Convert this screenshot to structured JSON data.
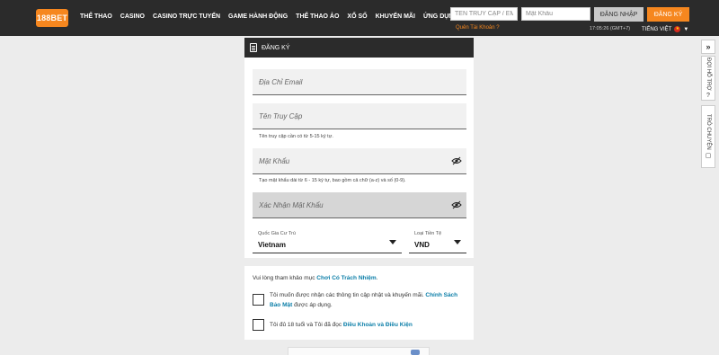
{
  "brand": {
    "logo_text": "188BET",
    "accent": "#f6871f",
    "dark": "#2b2b2b"
  },
  "nav": {
    "items": [
      "THỂ THAO",
      "CASINO",
      "CASINO TRỰC TUYẾN",
      "GAME HÀNH ĐỘNG",
      "THỂ THAO ẢO",
      "XỔ SỐ",
      "KHUYẾN MÃI",
      "ỨNG DỤNG"
    ]
  },
  "login": {
    "username_placeholder": "TÊN TRUY CẬP / EMAIL",
    "password_placeholder": "Mật Khẩu",
    "login_label": "ĐĂNG NHẬP",
    "register_label": "ĐĂNG KÝ",
    "forgot_label": "Quên Tài Khoản ?",
    "clock": "17:05:26 (GMT+7)",
    "language": "TIẾNG VIỆT"
  },
  "side": {
    "collapse_glyph": "»",
    "help_label": "ĐỢI HỖ TRỢ",
    "chat_label": "TRÒ CHUYỆN"
  },
  "register": {
    "header": "ĐĂNG KÝ",
    "email_placeholder": "Địa Chỉ Email",
    "username_placeholder": "Tên Truy Cập",
    "username_hint": "Tên truy cập cần có từ 5-15 ký tự.",
    "password_placeholder": "Mật Khẩu",
    "password_hint": "Tạo mật khẩu dài từ 6 - 15 ký tự, bao gồm cả chữ (a-z) và số (0-9).",
    "confirm_placeholder": "Xác Nhận Mật Khẩu",
    "country_label": "Quốc Gia Cư Trú",
    "country_value": "Vietnam",
    "currency_label": "Loại Tiền Tệ",
    "currency_value": "VND"
  },
  "consent": {
    "note_prefix": "Vui lòng tham khảo mục ",
    "note_link": "Chơi Có Trách Nhiệm",
    "note_suffix": ".",
    "promo_text": "Tôi muốn được nhận các thông tin cập nhật và khuyến mãi. ",
    "promo_link": "Chính Sách Bảo Mật",
    "promo_suffix": " được áp dụng.",
    "age_text": "Tôi đủ 18 tuổi và Tôi đã đọc ",
    "age_link": "Điều Khoản và Điều Kiện"
  }
}
